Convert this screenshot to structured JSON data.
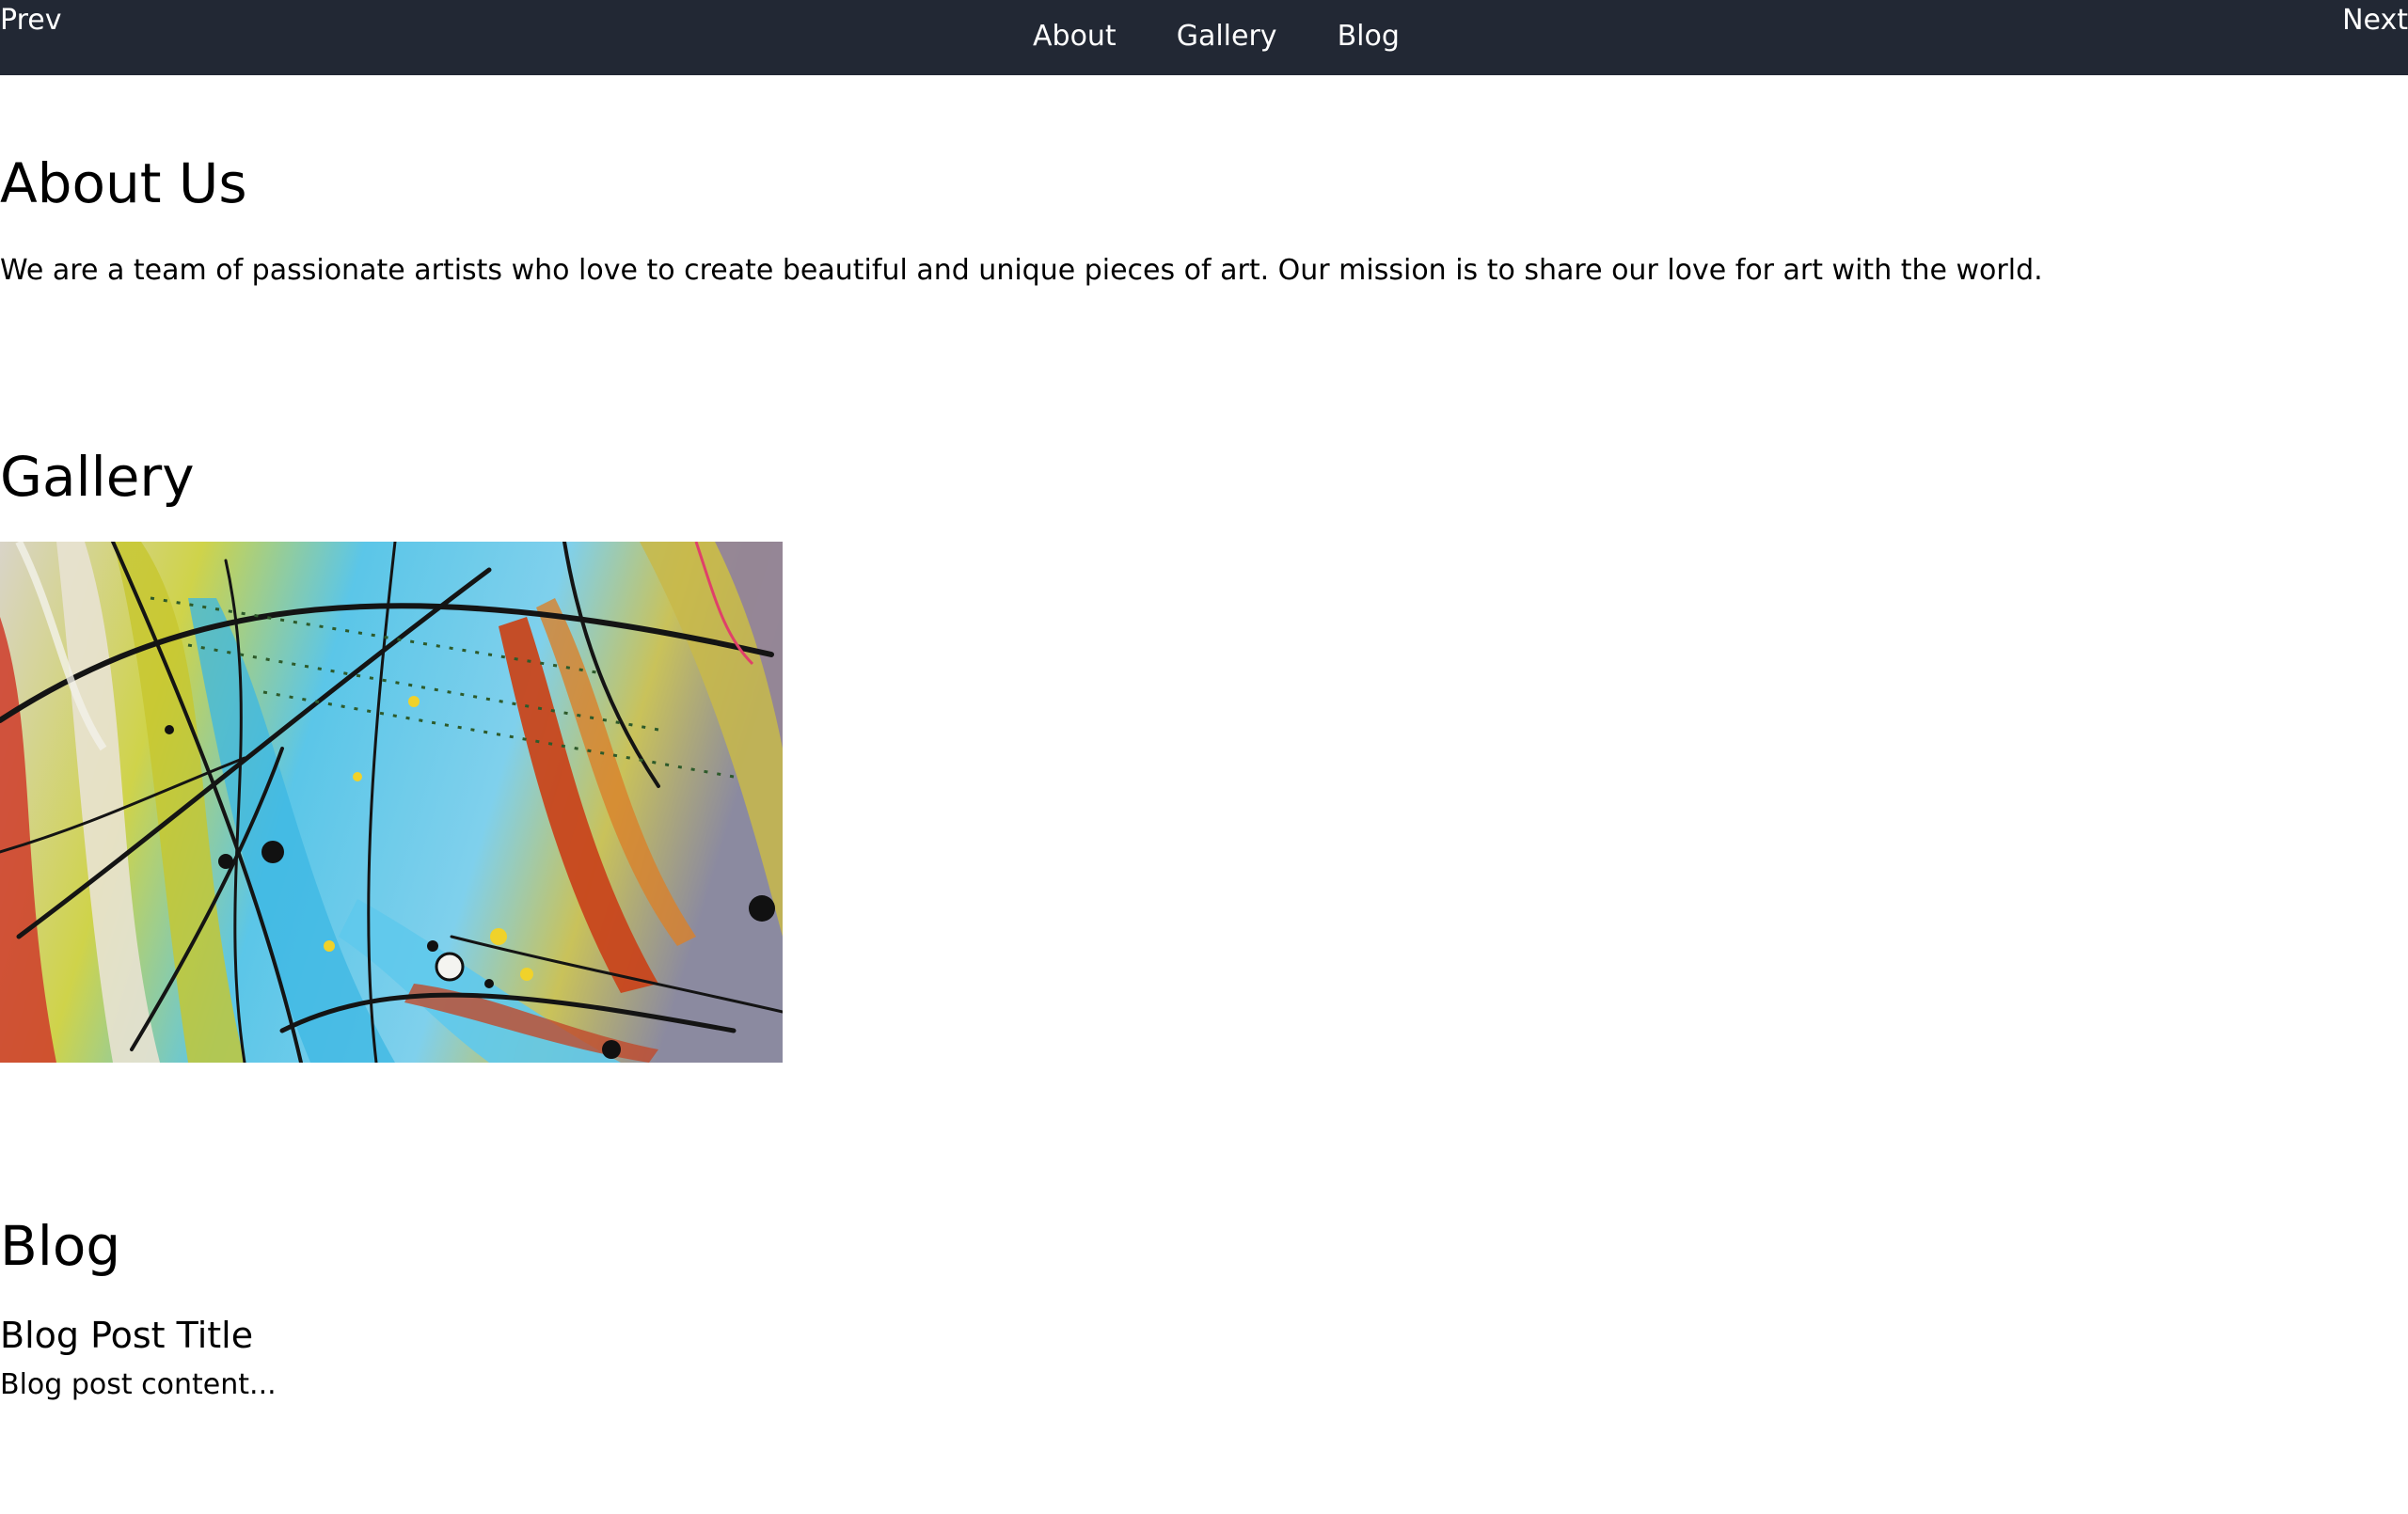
{
  "nav": {
    "prev_label": "Prev",
    "next_label": "Next",
    "links": [
      "About",
      "Gallery",
      "Blog"
    ]
  },
  "about": {
    "title": "About Us",
    "text": "We are a team of passionate artists who love to create beautiful and unique pieces of art. Our mission is to share our love for art with the world."
  },
  "gallery": {
    "title": "Gallery"
  },
  "blog": {
    "title": "Blog",
    "post_title": "Blog Post Title",
    "post_body": "Blog post content..."
  },
  "colors": {
    "header_bg": "#222834",
    "header_text": "#ffffff",
    "body_text": "#000000"
  }
}
